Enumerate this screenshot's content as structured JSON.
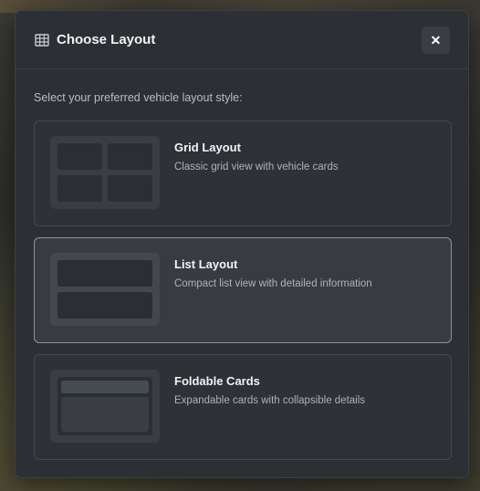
{
  "modal": {
    "title": "Choose Layout",
    "header_icon": "grid-icon",
    "close_icon": "close-icon",
    "close_label": "✕",
    "instruction": "Select your preferred vehicle layout style:"
  },
  "options": [
    {
      "title": "Grid Layout",
      "description": "Classic grid view with vehicle cards",
      "selected": false
    },
    {
      "title": "List Layout",
      "description": "Compact list view with detailed information",
      "selected": true
    },
    {
      "title": "Foldable Cards",
      "description": "Expandable cards with collapsible details",
      "selected": false
    }
  ],
  "colors": {
    "modal_bg": "#2c2f33",
    "selected_border": "#8d939a",
    "text_primary": "#f1f3f5",
    "text_secondary": "#aeb3b9"
  }
}
